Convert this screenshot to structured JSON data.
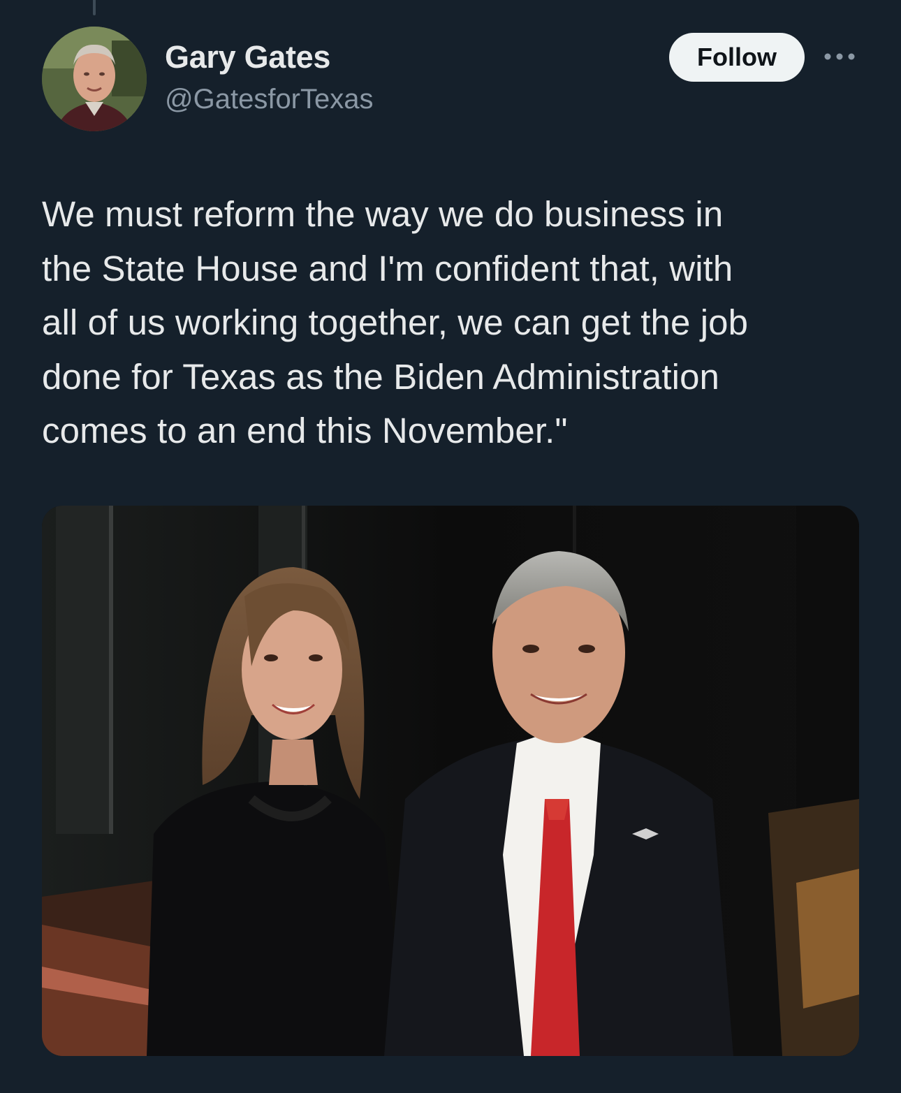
{
  "tweet": {
    "author": {
      "display_name": "Gary Gates",
      "handle": "@GatesforTexas"
    },
    "follow_label": "Follow",
    "more_icon": "more-horizontal-icon",
    "text": "We must reform the way we do business in\nthe State House and I'm confident that, with\nall of us working together, we can get the job\ndone for Texas as the Biden Administration\ncomes to an end this November.\"",
    "media": {
      "type": "photo"
    }
  },
  "colors": {
    "background": "#15202b",
    "primary_text": "#e7e9ea",
    "secondary_text": "#8b98a5",
    "follow_button_bg": "#eff3f4",
    "follow_button_text": "#0f1419"
  }
}
